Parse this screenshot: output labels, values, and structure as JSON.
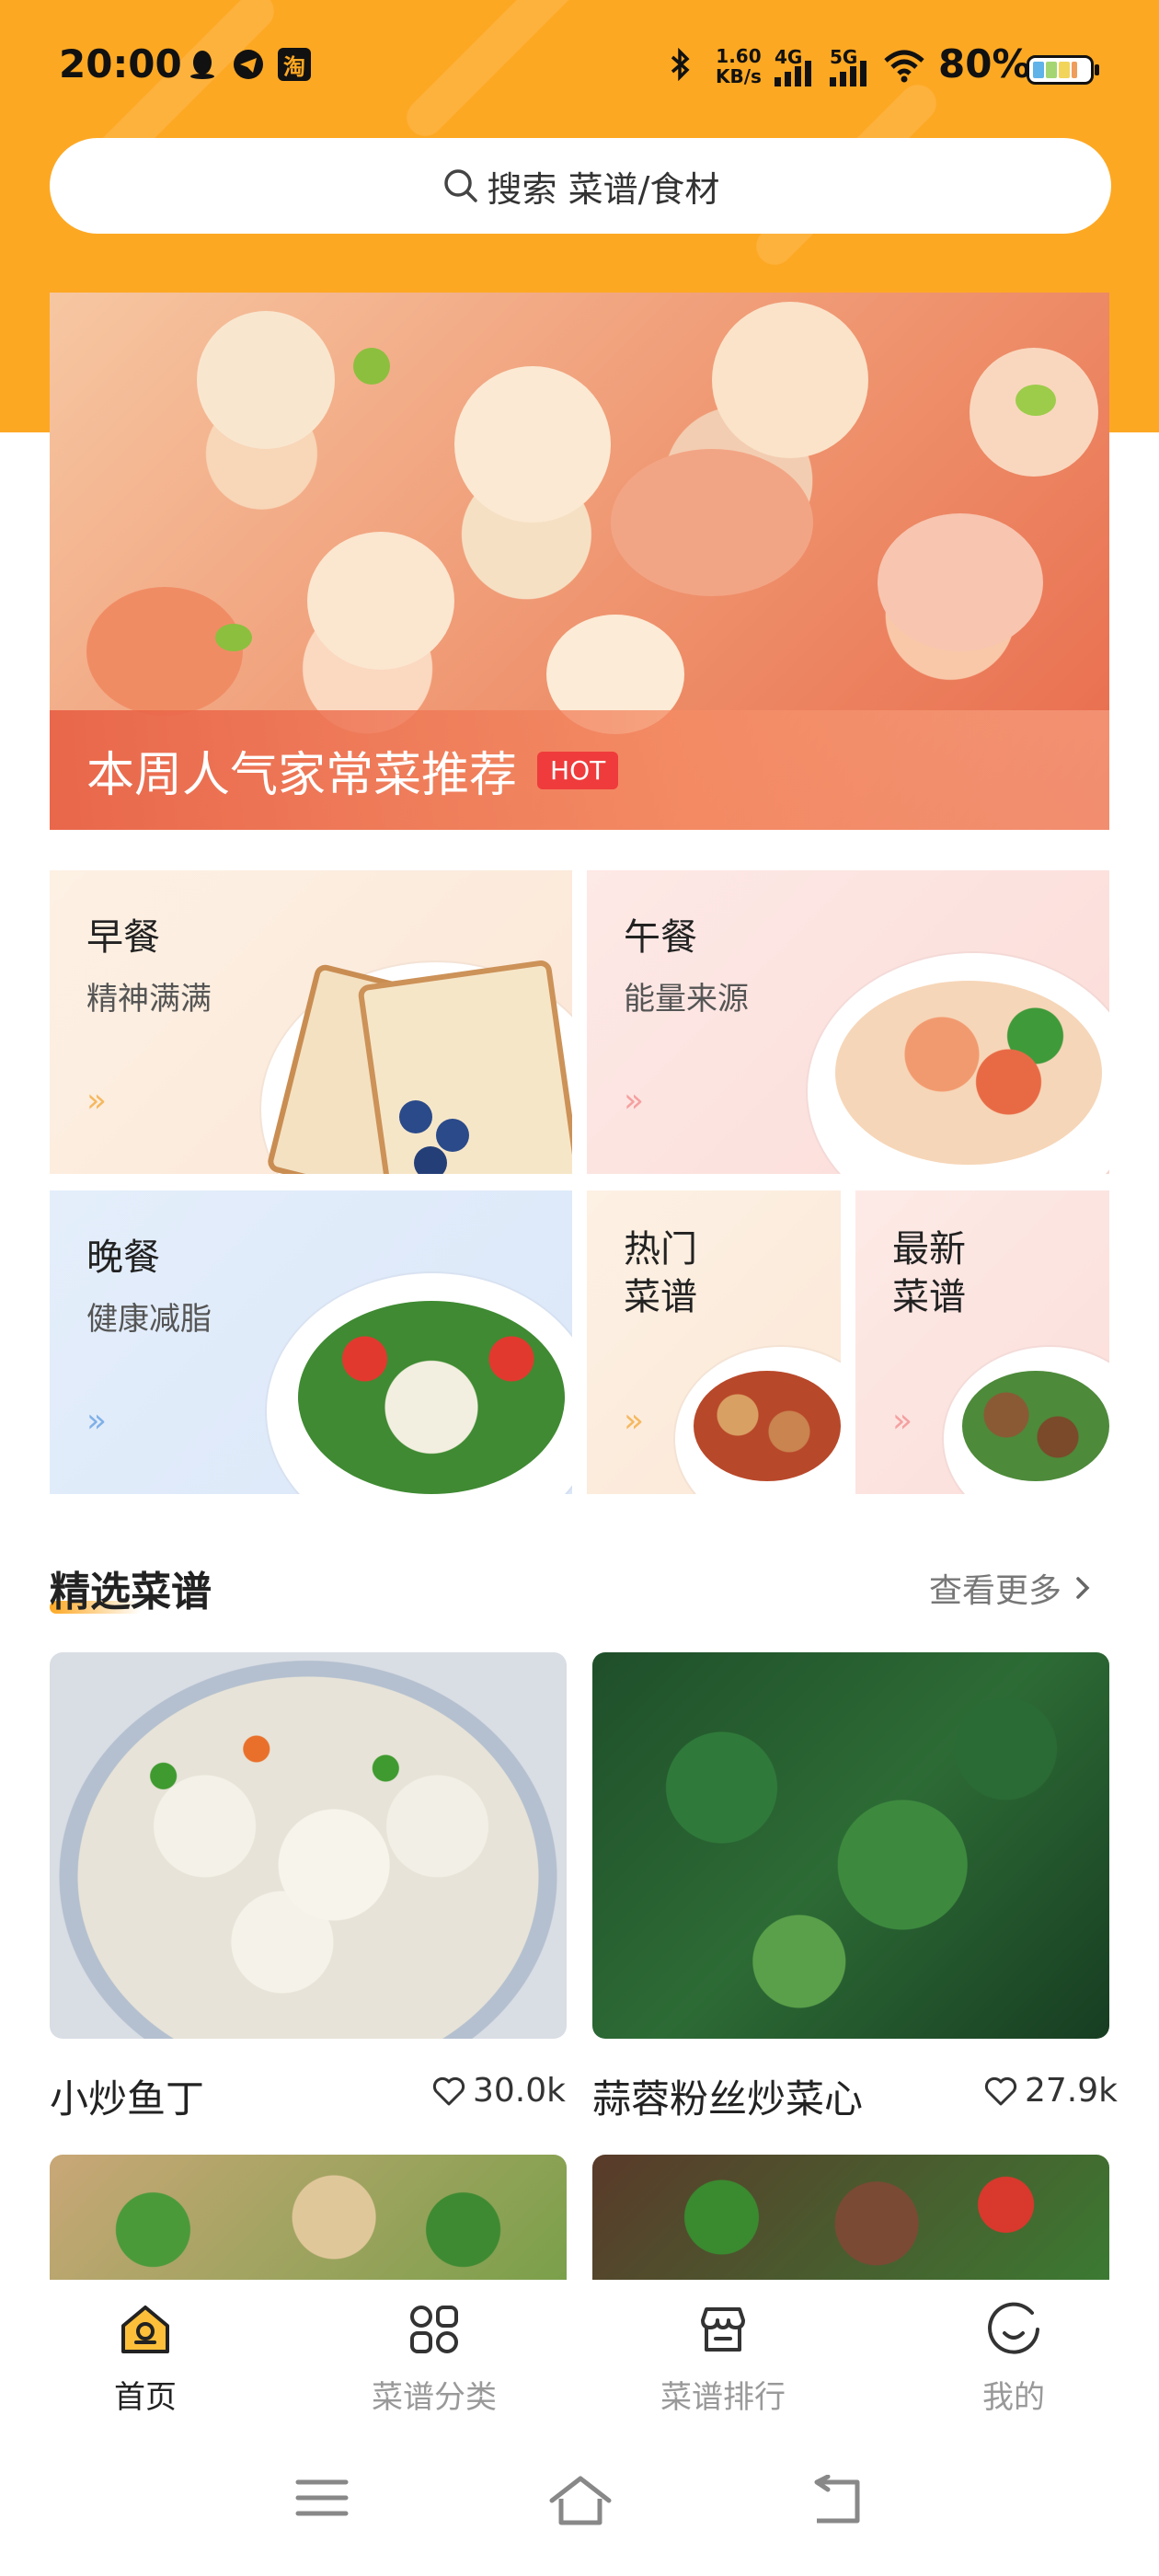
{
  "status_bar": {
    "time": "20:00",
    "net_speed_top": "1.60",
    "net_speed_unit": "KB/s",
    "net_4g": "4G",
    "net_5g": "5G",
    "battery": "80%",
    "app_icon_taobao": "淘"
  },
  "search": {
    "placeholder": "搜索 菜谱/食材"
  },
  "banner": {
    "title": "本周人气家常菜推荐",
    "badge": "HOT"
  },
  "categories": [
    {
      "title": "早餐",
      "subtitle": "精神满满",
      "chev_color": "#f5b860"
    },
    {
      "title": "午餐",
      "subtitle": "能量来源",
      "chev_color": "#f5a0a0"
    },
    {
      "title": "晚餐",
      "subtitle": "健康减脂",
      "chev_color": "#7fb0e8"
    },
    {
      "title": "热门\n菜谱",
      "line1": "热门",
      "line2": "菜谱",
      "chev_color": "#f5b860"
    },
    {
      "title": "最新\n菜谱",
      "line1": "最新",
      "line2": "菜谱",
      "chev_color": "#f5a0a0"
    }
  ],
  "featured": {
    "title": "精选菜谱",
    "more": "查看更多",
    "recipes": [
      {
        "name": "小炒鱼丁",
        "likes": "30.0k"
      },
      {
        "name": "蒜蓉粉丝炒菜心",
        "likes": "27.9k"
      }
    ]
  },
  "tabs": [
    {
      "label": "首页",
      "icon": "home-icon",
      "active": true
    },
    {
      "label": "菜谱分类",
      "icon": "category-grid-icon",
      "active": false
    },
    {
      "label": "菜谱排行",
      "icon": "ranking-store-icon",
      "active": false
    },
    {
      "label": "我的",
      "icon": "profile-smile-icon",
      "active": false
    }
  ],
  "colors": {
    "accent": "#fda823",
    "hot_badge": "#ef3b3b"
  }
}
